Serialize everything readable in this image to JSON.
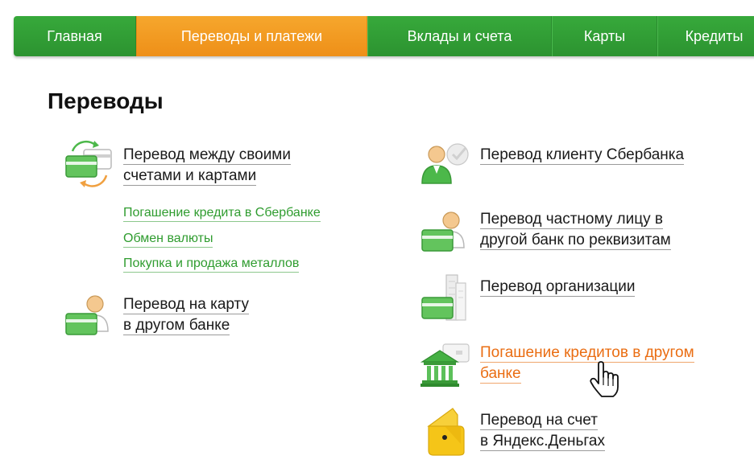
{
  "nav": {
    "tabs": [
      {
        "label": "Главная",
        "width": 152,
        "active": false
      },
      {
        "label": "Переводы и платежи",
        "width": 287,
        "active": true
      },
      {
        "label": "Вклады и счета",
        "width": 229,
        "active": false
      },
      {
        "label": "Карты",
        "width": 131,
        "active": false
      },
      {
        "label": "Кредиты",
        "width": 141,
        "active": false
      }
    ]
  },
  "page": {
    "title": "Переводы"
  },
  "left": {
    "own_transfer": {
      "line1": "Перевод между своими",
      "line2": "счетами и картами"
    },
    "sub_links": [
      "Погашение кредита в Сбербанке",
      "Обмен валюты",
      "Покупка и продажа металлов"
    ],
    "card_transfer": {
      "line1": "Перевод на карту",
      "line2": "в другом банке"
    }
  },
  "right": {
    "sber_client": {
      "line1": "Перевод клиенту Сбербанка"
    },
    "private_person": {
      "line1": "Перевод частному лицу в",
      "line2": "другой банк по реквизитам"
    },
    "organization": {
      "line1": "Перевод организации"
    },
    "loan_other_bank": {
      "line1": "Погашение кредитов в другом",
      "line2": "банке"
    },
    "yandex": {
      "line1": "Перевод на счет",
      "line2": "в Яндекс.Деньгах"
    }
  },
  "colors": {
    "nav_green": "#2e9a32",
    "nav_orange": "#f39c20",
    "link_green": "#2f9c2f",
    "link_orange": "#ea6d12",
    "card_green": "#4cb84a",
    "yandex_yellow": "#f5c518"
  },
  "icons": {
    "own_transfer": "cards-exchange-icon",
    "card_transfer": "person-card-icon",
    "sber_client": "person-sber-icon",
    "private_person": "person-card-icon",
    "organization": "building-card-icon",
    "loan_other_bank": "bank-icon",
    "yandex": "yandex-wallet-icon",
    "cursor": "hand-pointer-icon"
  }
}
